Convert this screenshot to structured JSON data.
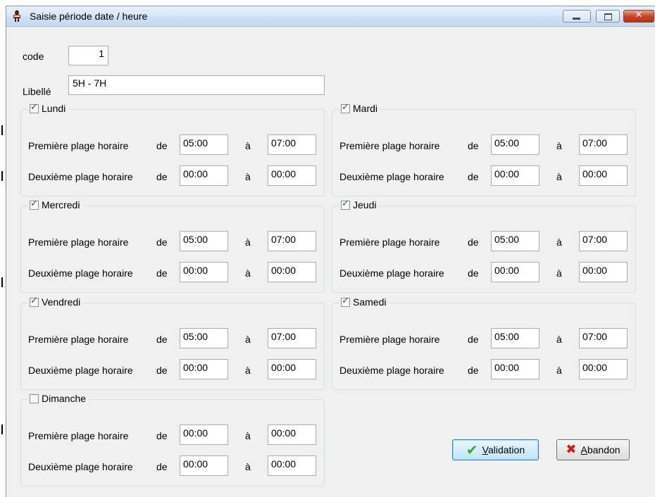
{
  "window": {
    "title": "Saisie période date / heure",
    "close_glyph": "✕"
  },
  "form": {
    "code_label": "code",
    "code_value": "1",
    "libelle_label": "Libellé",
    "libelle_value": "5H - 7H"
  },
  "common": {
    "first_range_label": "Première plage horaire",
    "second_range_label": "Deuxième plage horaire",
    "from_label": "de",
    "to_label": "à"
  },
  "days": {
    "lundi": {
      "label": "Lundi",
      "checked": true,
      "r1_from": "05:00",
      "r1_to": "07:00",
      "r2_from": "00:00",
      "r2_to": "00:00"
    },
    "mardi": {
      "label": "Mardi",
      "checked": true,
      "r1_from": "05:00",
      "r1_to": "07:00",
      "r2_from": "00:00",
      "r2_to": "00:00"
    },
    "mercredi": {
      "label": "Mercredi",
      "checked": true,
      "r1_from": "05:00",
      "r1_to": "07:00",
      "r2_from": "00:00",
      "r2_to": "00:00"
    },
    "jeudi": {
      "label": "Jeudi",
      "checked": true,
      "r1_from": "05:00",
      "r1_to": "07:00",
      "r2_from": "00:00",
      "r2_to": "00:00"
    },
    "vendredi": {
      "label": "Vendredi",
      "checked": true,
      "r1_from": "05:00",
      "r1_to": "07:00",
      "r2_from": "00:00",
      "r2_to": "00:00"
    },
    "samedi": {
      "label": "Samedi",
      "checked": true,
      "r1_from": "05:00",
      "r1_to": "07:00",
      "r2_from": "00:00",
      "r2_to": "00:00"
    },
    "dimanche": {
      "label": "Dimanche",
      "checked": false,
      "r1_from": "00:00",
      "r1_to": "00:00",
      "r2_from": "00:00",
      "r2_to": "00:00"
    }
  },
  "buttons": {
    "validate_first": "V",
    "validate_rest": "alidation",
    "abandon_first": "A",
    "abandon_rest": "bandon",
    "validate_icon_glyph": "✔",
    "abandon_icon_glyph": "✖"
  }
}
